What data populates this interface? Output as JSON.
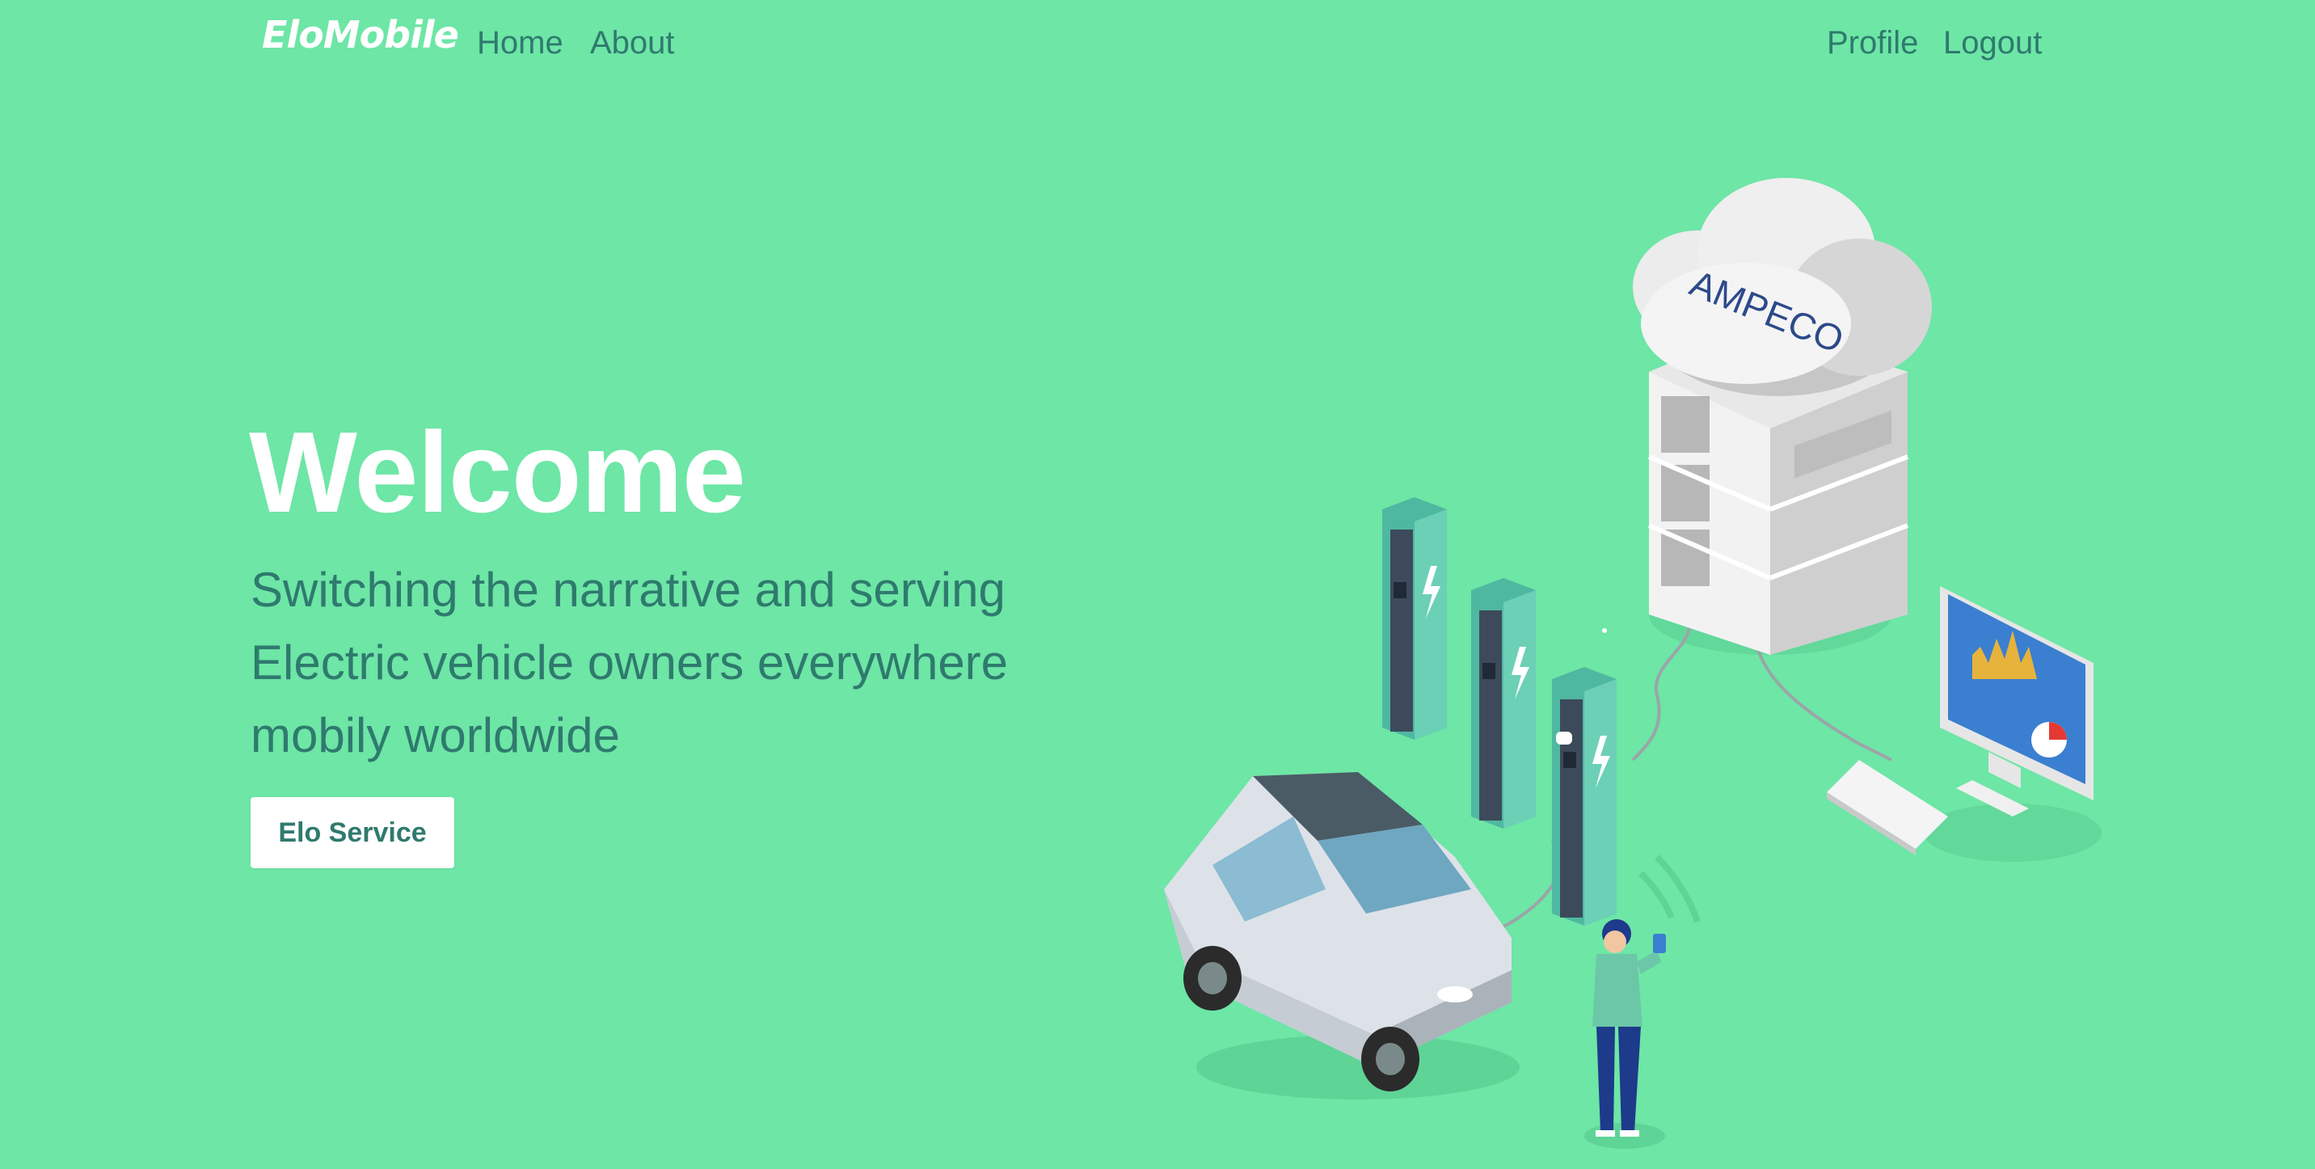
{
  "nav": {
    "brand": "EloMobile",
    "links": [
      {
        "label": "Home"
      },
      {
        "label": "About"
      }
    ],
    "right_links": [
      {
        "label": "Profile"
      },
      {
        "label": "Logout"
      }
    ]
  },
  "hero": {
    "title": "Welcome",
    "lines": [
      "Switching the narrative and serving",
      "Electric vehicle owners everywhere",
      "mobily worldwide"
    ],
    "cta_label": "Elo Service"
  },
  "illustration": {
    "cloud_label": "AMPECO",
    "icons": [
      "cloud-server-icon",
      "charging-station-icon",
      "electric-car-icon",
      "person-with-phone-icon",
      "computer-monitor-icon",
      "keyboard-icon"
    ]
  },
  "colors": {
    "background": "#6de6a6",
    "accent_text": "#2f7a6e",
    "white": "#ffffff",
    "station_teal": "#4fb8a0",
    "station_dark": "#3d4a5c",
    "person_blue": "#1e3a8a"
  }
}
